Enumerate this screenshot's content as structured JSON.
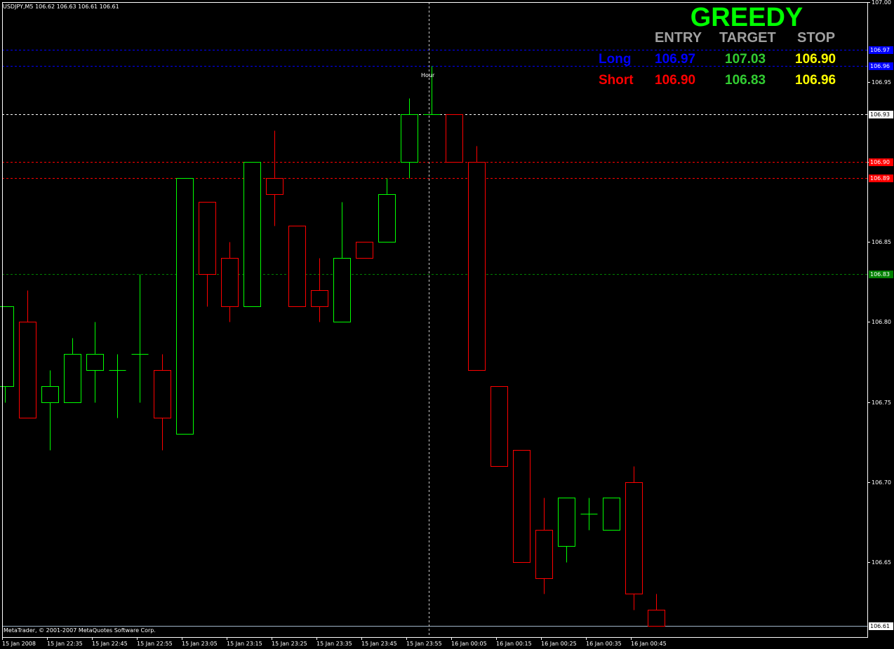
{
  "symbol_info": "USDJPY,M5  106.62 106.63 106.61 106.61",
  "copyright": "MetaTrader, © 2001-2007 MetaQuotes Software Corp.",
  "hour_label": "Hour",
  "panel": {
    "title": "GREEDY",
    "headers": {
      "entry": "ENTRY",
      "target": "TARGET",
      "stop": "STOP"
    },
    "long": {
      "label": "Long",
      "entry": "106.97",
      "target": "107.03",
      "stop": "106.90"
    },
    "short": {
      "label": "Short",
      "entry": "106.90",
      "target": "106.83",
      "stop": "106.96"
    },
    "colors": {
      "title": "#00ff00",
      "header": "#a0a0a0",
      "long": "#0000ff",
      "short": "#ff0000",
      "target": "#32cd32",
      "stop": "#ffff00"
    }
  },
  "chart_data": {
    "type": "candlestick",
    "y_range": [
      106.603,
      107.0
    ],
    "y_ticks": [
      "107.00",
      "106.95",
      "106.90",
      "106.85",
      "106.80",
      "106.75",
      "106.70",
      "106.65"
    ],
    "x_labels": [
      "15 Jan 2008",
      "15 Jan 22:35",
      "15 Jan 22:45",
      "15 Jan 22:55",
      "15 Jan 23:05",
      "15 Jan 23:15",
      "15 Jan 23:25",
      "15 Jan 23:35",
      "15 Jan 23:45",
      "15 Jan 23:55",
      "16 Jan 00:05",
      "16 Jan 00:15",
      "16 Jan 00:25",
      "16 Jan 00:35",
      "16 Jan 00:45"
    ],
    "candles": [
      {
        "o": 106.76,
        "h": 106.81,
        "l": 106.75,
        "c": 106.81
      },
      {
        "o": 106.8,
        "h": 106.82,
        "l": 106.74,
        "c": 106.74
      },
      {
        "o": 106.75,
        "h": 106.77,
        "l": 106.72,
        "c": 106.76
      },
      {
        "o": 106.75,
        "h": 106.79,
        "l": 106.75,
        "c": 106.78
      },
      {
        "o": 106.77,
        "h": 106.8,
        "l": 106.75,
        "c": 106.78
      },
      {
        "o": 106.77,
        "h": 106.78,
        "l": 106.74,
        "c": 106.77
      },
      {
        "o": 106.78,
        "h": 106.83,
        "l": 106.75,
        "c": 106.78
      },
      {
        "o": 106.77,
        "h": 106.78,
        "l": 106.72,
        "c": 106.74
      },
      {
        "o": 106.73,
        "h": 106.89,
        "l": 106.73,
        "c": 106.89
      },
      {
        "o": 106.875,
        "h": 106.875,
        "l": 106.81,
        "c": 106.83
      },
      {
        "o": 106.84,
        "h": 106.85,
        "l": 106.8,
        "c": 106.81
      },
      {
        "o": 106.81,
        "h": 106.9,
        "l": 106.81,
        "c": 106.9
      },
      {
        "o": 106.89,
        "h": 106.92,
        "l": 106.86,
        "c": 106.88
      },
      {
        "o": 106.86,
        "h": 106.86,
        "l": 106.81,
        "c": 106.81
      },
      {
        "o": 106.82,
        "h": 106.84,
        "l": 106.8,
        "c": 106.81
      },
      {
        "o": 106.8,
        "h": 106.875,
        "l": 106.8,
        "c": 106.84
      },
      {
        "o": 106.85,
        "h": 106.85,
        "l": 106.84,
        "c": 106.84
      },
      {
        "o": 106.85,
        "h": 106.89,
        "l": 106.85,
        "c": 106.88
      },
      {
        "o": 106.9,
        "h": 106.94,
        "l": 106.89,
        "c": 106.93
      },
      {
        "o": 106.93,
        "h": 106.96,
        "l": 106.93,
        "c": 106.93
      },
      {
        "o": 106.93,
        "h": 106.93,
        "l": 106.9,
        "c": 106.9
      },
      {
        "o": 106.9,
        "h": 106.91,
        "l": 106.77,
        "c": 106.77
      },
      {
        "o": 106.76,
        "h": 106.76,
        "l": 106.71,
        "c": 106.71
      },
      {
        "o": 106.72,
        "h": 106.72,
        "l": 106.65,
        "c": 106.65
      },
      {
        "o": 106.67,
        "h": 106.69,
        "l": 106.63,
        "c": 106.64
      },
      {
        "o": 106.66,
        "h": 106.69,
        "l": 106.65,
        "c": 106.69
      },
      {
        "o": 106.68,
        "h": 106.69,
        "l": 106.67,
        "c": 106.68
      },
      {
        "o": 106.67,
        "h": 106.69,
        "l": 106.67,
        "c": 106.69
      },
      {
        "o": 106.7,
        "h": 106.71,
        "l": 106.62,
        "c": 106.63
      },
      {
        "o": 106.62,
        "h": 106.63,
        "l": 106.61,
        "c": 106.61
      }
    ],
    "levels": [
      {
        "price": 106.97,
        "label": "106.97",
        "color": "#0000ff",
        "style": "dashed"
      },
      {
        "price": 106.96,
        "label": "106.96",
        "color": "#0000ff",
        "style": "dashed"
      },
      {
        "price": 106.93,
        "label": "106.93",
        "color": "#ffffff",
        "style": "dashed"
      },
      {
        "price": 106.9,
        "label": "106.90",
        "color": "#ff0000",
        "style": "dashed"
      },
      {
        "price": 106.89,
        "label": "106.89",
        "color": "#ff0000",
        "style": "dashed"
      },
      {
        "price": 106.83,
        "label": "106.83",
        "color": "#008000",
        "style": "dashed"
      },
      {
        "price": 106.61,
        "label": "106.61",
        "color": "#a0b4c8",
        "style": "solid"
      }
    ],
    "up_color": "#00ff00",
    "down_color": "#ff0000",
    "grid": false
  }
}
